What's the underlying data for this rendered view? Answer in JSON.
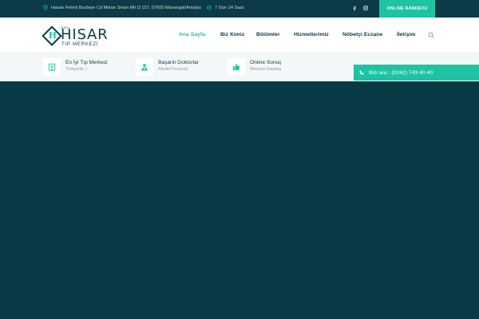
{
  "topbar": {
    "address": "Hasan Fehmi Boztepe Cd Mimar Sinan Mh D:157, 07600 Manavgat/Antalya",
    "hours": "7 Gün 24 Saat",
    "appointment_label": "ONLINE RANDEVU",
    "icons": {
      "location": "map-pin-icon",
      "clock": "clock-icon",
      "facebook": "facebook-icon",
      "instagram": "instagram-icon"
    }
  },
  "logo": {
    "prefix": "ÖZEL",
    "mark": "H",
    "name": "HISAR",
    "tagline": "TIP MERKEZİ"
  },
  "nav": {
    "items": [
      {
        "label": "Ana Sayfa",
        "active": true
      },
      {
        "label": "Biz Kimiz"
      },
      {
        "label": "Bölümler"
      },
      {
        "label": "Hizmetlerimiz"
      },
      {
        "label": "Nöbetçi Eczane"
      },
      {
        "label": "İletişim"
      }
    ]
  },
  "features": [
    {
      "title": "En İyi Tıp Merkezi",
      "subtitle": "Türkiye'de :)",
      "icon": "hospital-icon"
    },
    {
      "title": "Başarılı Doktorlar",
      "subtitle": "Nitelikli Personel",
      "icon": "doctor-icon"
    },
    {
      "title": "Online Sonuç",
      "subtitle": "Memnun Hastalar",
      "icon": "thumbs-up-icon"
    }
  ],
  "call": {
    "label": "Bizi ara : (0242) 743 40 40",
    "icon": "phone-icon"
  },
  "colors": {
    "dark": "#0b3b47",
    "accent": "#1ec3a4",
    "hero": "#083a46",
    "strip": "#f4f7f7"
  }
}
